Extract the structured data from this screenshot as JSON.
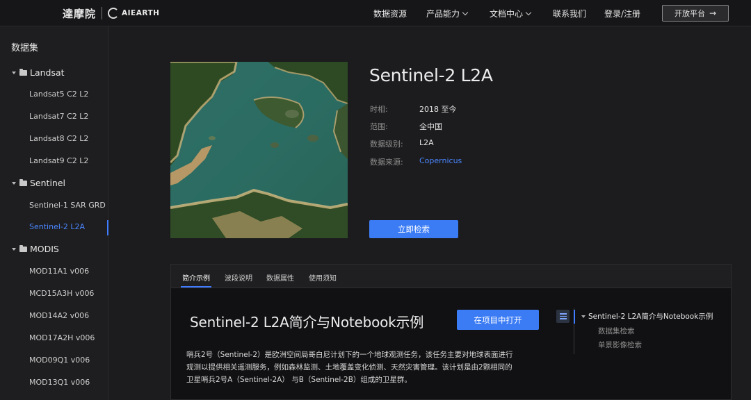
{
  "header": {
    "logo_cn": "達摩院",
    "logo_en": "AIEARTH",
    "nav": [
      {
        "label": "数据资源",
        "has_dropdown": false
      },
      {
        "label": "产品能力",
        "has_dropdown": true
      },
      {
        "label": "文档中心",
        "has_dropdown": true
      },
      {
        "label": "联系我们",
        "has_dropdown": false
      },
      {
        "label": "登录/注册",
        "has_dropdown": false
      }
    ],
    "open_platform": "开放平台",
    "open_platform_arrow": "→"
  },
  "sidebar": {
    "title": "数据集",
    "groups": [
      {
        "label": "Landsat",
        "items": [
          "Landsat5 C2 L2",
          "Landsat7 C2 L2",
          "Landsat8 C2 L2",
          "Landsat9 C2 L2"
        ]
      },
      {
        "label": "Sentinel",
        "items": [
          "Sentinel-1 SAR GRD",
          "Sentinel-2 L2A"
        ]
      },
      {
        "label": "MODIS",
        "items": [
          "MOD11A1 v006",
          "MCD15A3H v006",
          "MOD14A2 v006",
          "MOD17A2H v006",
          "MOD09Q1 v006",
          "MOD13Q1 v006"
        ]
      }
    ],
    "active_item": "Sentinel-2 L2A"
  },
  "dataset": {
    "title": "Sentinel-2 L2A",
    "meta": [
      {
        "label": "时相:",
        "value": "2018 至今"
      },
      {
        "label": "范围:",
        "value": "全中国"
      },
      {
        "label": "数据级别:",
        "value": "L2A"
      },
      {
        "label": "数据来源:",
        "value": "Copernicus"
      }
    ],
    "search_button": "立即检索",
    "colors": {
      "accent": "#3b7cf5",
      "link": "#4a86ff"
    }
  },
  "tabs": {
    "items": [
      "简介示例",
      "波段说明",
      "数据属性",
      "使用须知"
    ],
    "active": "简介示例"
  },
  "notebook": {
    "title": "Sentinel-2 L2A简介与Notebook示例",
    "open_button": "在项目中打开",
    "paragraph_lines": [
      "哨兵2号（Sentinel-2）是欧洲空间局哥白尼计划下的一个地球观测任务，该任务主要对地球表面进行",
      "观测以提供相关遥测服务，例如森林监测、土地覆盖变化侦测、天然灾害管理。该计划是由2颗相同的",
      "卫星哨兵2号A（Sentinel-2A） 与B（Sentinel-2B）组成的卫星群。"
    ]
  },
  "toc": {
    "main": "Sentinel-2 L2A简介与Notebook示例",
    "subs": [
      "数据集检索",
      "单景影像检索"
    ]
  }
}
